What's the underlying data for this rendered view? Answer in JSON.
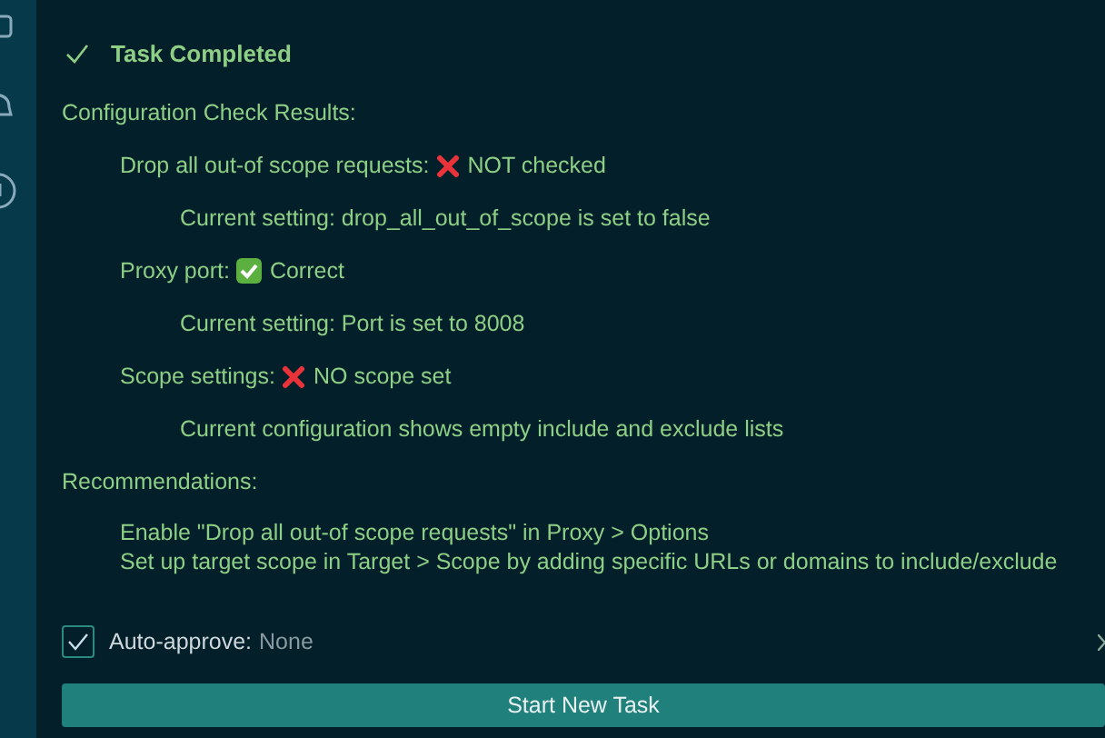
{
  "task": {
    "title": "Task Completed"
  },
  "heading": "Configuration Check Results:",
  "checks": [
    {
      "label": "Drop all out-of scope requests:",
      "kind": "fail",
      "result": "NOT checked",
      "detail": "Current setting: drop_all_out_of_scope is set to false"
    },
    {
      "label": "Proxy port:",
      "kind": "pass",
      "result": "Correct",
      "detail": "Current setting: Port is set to 8008"
    },
    {
      "label": "Scope settings:",
      "kind": "fail",
      "result": "NO scope set",
      "detail": "Current configuration shows empty include and exclude lists"
    }
  ],
  "recommendations": {
    "heading": "Recommendations:",
    "items": [
      "Enable \"Drop all out-of scope requests\" in Proxy > Options",
      "Set up target scope in Target > Scope by adding specific URLs or domains to include/exclude"
    ]
  },
  "auto_approve": {
    "checked": true,
    "label": "Auto-approve:",
    "value": "None"
  },
  "buttons": [
    "Start New Task"
  ]
}
